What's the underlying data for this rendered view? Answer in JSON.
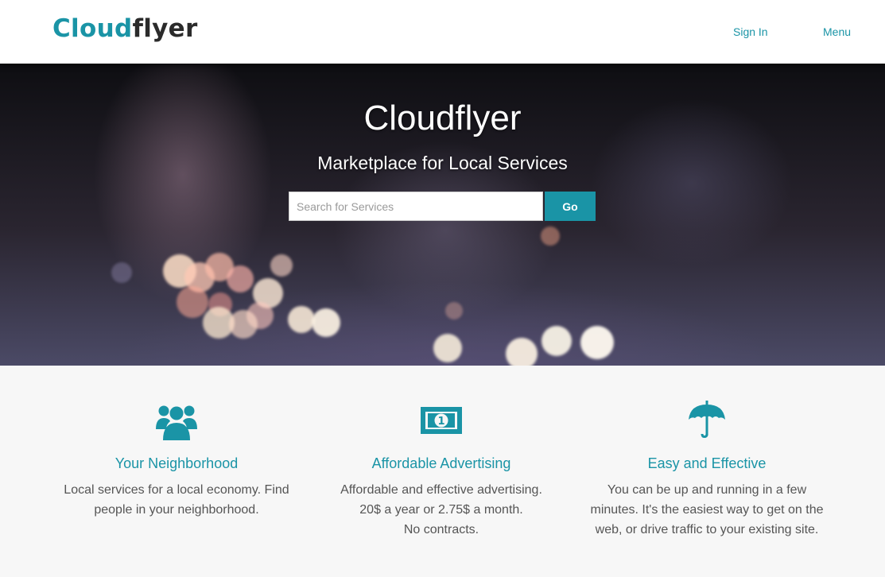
{
  "navbar": {
    "logo_part1": "Cloud",
    "logo_part2": "flyer",
    "sign_in": "Sign In",
    "menu": "Menu"
  },
  "hero": {
    "title": "Cloudflyer",
    "subtitle": "Marketplace for Local Services",
    "search_placeholder": "Search for Services",
    "search_value": "",
    "go_label": "Go"
  },
  "features": [
    {
      "icon": "users-icon",
      "title": "Your Neighborhood",
      "lines": [
        "Local services for a local economy. Find",
        "people in your neighborhood."
      ]
    },
    {
      "icon": "money-icon",
      "title": "Affordable Advertising",
      "lines": [
        "Affordable and effective advertising.",
        "20$ a year or 2.75$ a month.",
        "No contracts."
      ]
    },
    {
      "icon": "umbrella-icon",
      "title": "Easy and Effective",
      "lines": [
        "You can be up and running in a few",
        "minutes. It's the easiest way to get on the",
        "web, or drive traffic to your existing site."
      ]
    }
  ],
  "colors": {
    "accent": "#1a94a6",
    "text": "#555555",
    "logo_dark": "#2b2b2b",
    "section_bg": "#f7f7f7"
  }
}
